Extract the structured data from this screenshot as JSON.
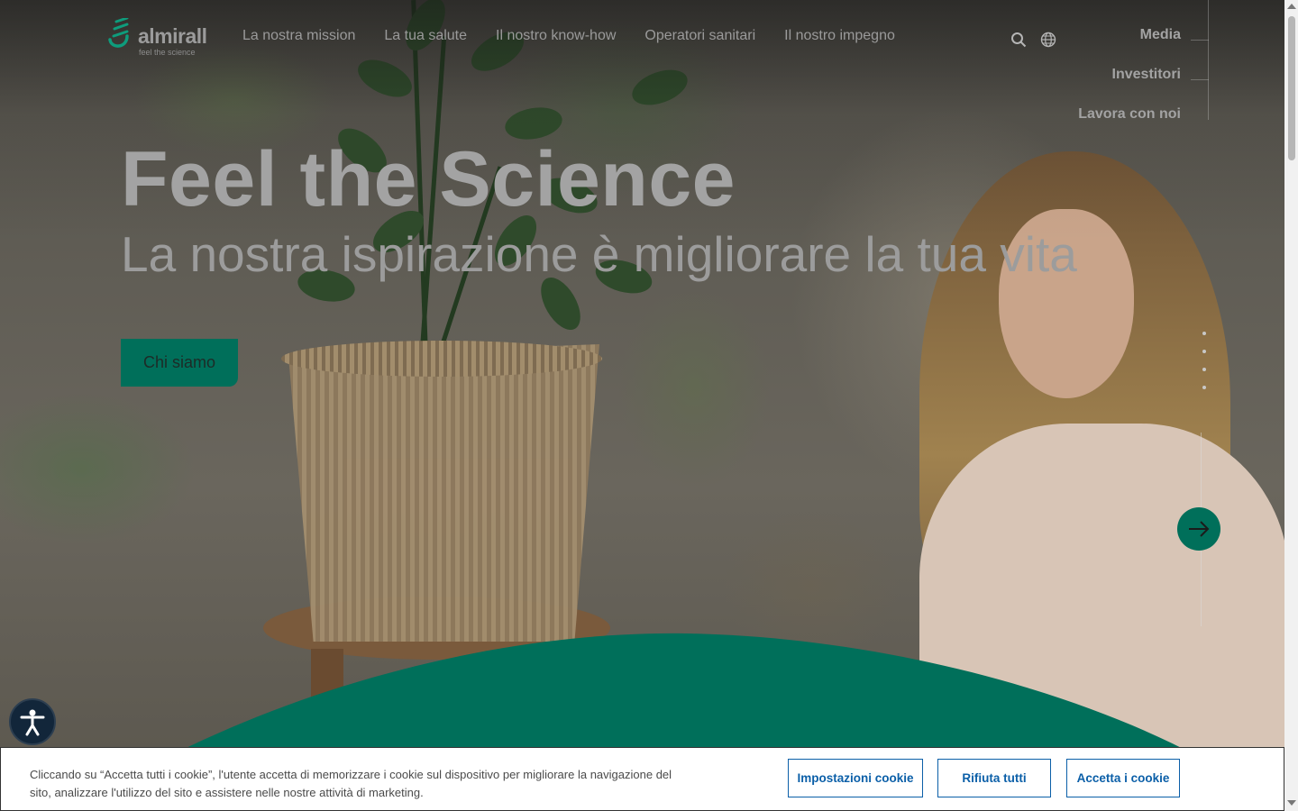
{
  "logo": {
    "word": "almirall",
    "tagline": "feel the science"
  },
  "nav": {
    "items": [
      "La nostra mission",
      "La tua salute",
      "Il nostro know-how",
      "Operatori sanitari",
      "Il nostro impegno"
    ]
  },
  "side_links": [
    "Media",
    "Investitori",
    "Lavora con noi"
  ],
  "icons": {
    "search": "search-icon",
    "language": "globe-icon",
    "next": "arrow-right-icon",
    "accessibility": "accessibility-icon"
  },
  "hero": {
    "title": "Feel the Science",
    "subtitle": "La nostra ispirazione è migliorare la tua vita",
    "cta_label": "Chi siamo"
  },
  "cookie": {
    "text": "Cliccando su “Accetta tutti i cookie”, l'utente accetta di memorizzare i cookie sul dispositivo per migliorare la navigazione del sito, analizzare l'utilizzo del sito e assistere nelle nostre attività di marketing.",
    "settings_label": "Impostazioni cookie",
    "reject_label": "Rifiuta tutti",
    "accept_label": "Accetta i cookie"
  },
  "colors": {
    "brand_green": "#006f5a",
    "cookie_button": "#0b5fa8"
  }
}
